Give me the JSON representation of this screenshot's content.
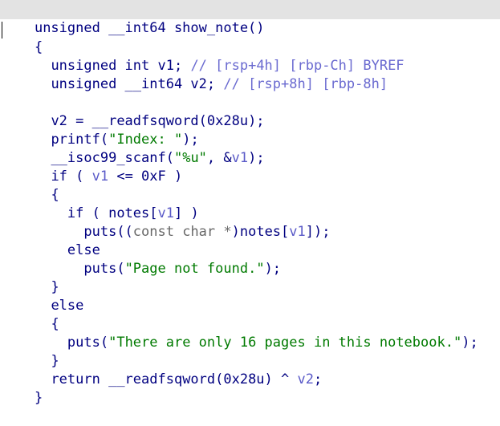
{
  "header": {
    "signature": "unsigned __int64 show_note()"
  },
  "code": {
    "open_brace": "{",
    "decl1_type": "unsigned int v1; ",
    "decl1_comment": "// [rsp+4h] [rbp-Ch] BYREF",
    "decl2_type": "unsigned __int64 v2; ",
    "decl2_comment": "// [rsp+8h] [rbp-8h]",
    "l_v2_pre": "v2 = __readfsqword(0x28u);",
    "l_printf_a": "printf(",
    "l_printf_str": "\"Index: \"",
    "l_printf_b": ");",
    "l_scanf_a": "__isoc99_scanf(",
    "l_scanf_str": "\"%u\"",
    "l_scanf_b": ", &",
    "l_scanf_var": "v1",
    "l_scanf_c": ");",
    "l_if1_a": "if ( ",
    "l_if1_var": "v1",
    "l_if1_b": " <= 0xF )",
    "brace_open_inner": "{",
    "l_if2_a": "if ( notes[",
    "l_if2_var": "v1",
    "l_if2_b": "] )",
    "l_puts1_a": "puts((",
    "l_puts1_cast": "const char *",
    "l_puts1_b": ")notes[",
    "l_puts1_var": "v1",
    "l_puts1_c": "]);",
    "l_else1": "else",
    "l_puts2_a": "puts(",
    "l_puts2_str": "\"Page not found.\"",
    "l_puts2_b": ");",
    "brace_close_inner": "}",
    "l_else2": "else",
    "brace_open_else": "{",
    "l_puts3_a": "puts(",
    "l_puts3_str": "\"There are only 16 pages in this notebook.\"",
    "l_puts3_b": ");",
    "brace_close_else": "}",
    "l_return_a": "return __readfsqword(0x28u) ^ ",
    "l_return_var": "v2",
    "l_return_b": ";",
    "close_brace": "}"
  },
  "colors": {
    "keyword": "#000080",
    "comment": "#6a6ad0",
    "string": "#007a00",
    "variable": "#5a5ac8",
    "cast": "#686868",
    "header_bg": "#e3e3e3"
  }
}
